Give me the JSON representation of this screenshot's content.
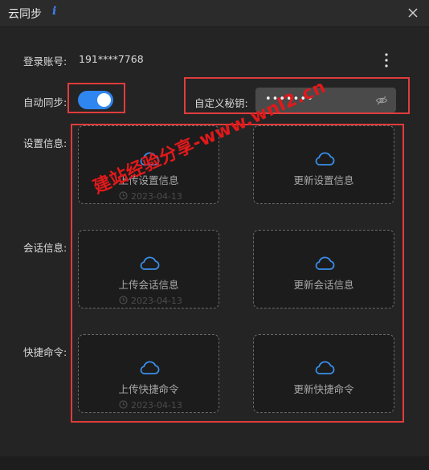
{
  "window": {
    "title": "云同步"
  },
  "account": {
    "label": "登录账号:",
    "value": "191****7768"
  },
  "auto_sync": {
    "label": "自动同步:",
    "enabled": true
  },
  "custom_key": {
    "label": "自定义秘钥:",
    "value": "•••••••"
  },
  "sections": [
    {
      "label": "设置信息:",
      "upload": {
        "label": "上传设置信息",
        "date": "2023-04-13"
      },
      "update": {
        "label": "更新设置信息"
      }
    },
    {
      "label": "会话信息:",
      "upload": {
        "label": "上传会话信息",
        "date": "2023-04-13"
      },
      "update": {
        "label": "更新会话信息"
      }
    },
    {
      "label": "快捷命令:",
      "upload": {
        "label": "上传快捷命令",
        "date": "2023-04-13"
      },
      "update": {
        "label": "更新快捷命令"
      }
    }
  ],
  "watermark": "建站经验分享-www.wnl2.cn",
  "colors": {
    "accent": "#2f86f0",
    "highlight_box": "#e03c3c",
    "watermark": "#e0191b",
    "cloud": "#3a8ee8"
  }
}
